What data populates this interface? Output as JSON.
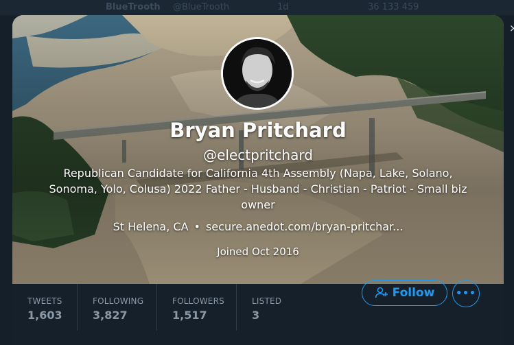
{
  "background_tweet": {
    "name": "BlueTrooth",
    "handle": "@BlueTrooth",
    "time": "1d",
    "stats": "36   133   459"
  },
  "profile": {
    "name": "Bryan Pritchard",
    "handle": "@electpritchard",
    "bio": "Republican Candidate for California 4th Assembly (Napa, Lake, Solano, Sonoma, Yolo, Colusa) 2022 Father - Husband - Christian - Patriot - Small biz owner",
    "location": "St Helena, CA",
    "separator": "•",
    "website": "secure.anedot.com/bryan-pritchar...",
    "joined": "Joined Oct 2016"
  },
  "stats": [
    {
      "label": "TWEETS",
      "value": "1,603"
    },
    {
      "label": "FOLLOWING",
      "value": "3,827"
    },
    {
      "label": "FOLLOWERS",
      "value": "1,517"
    },
    {
      "label": "LISTED",
      "value": "3"
    }
  ],
  "actions": {
    "follow_label": "Follow",
    "more_label": "•••",
    "close_label": "×"
  },
  "colors": {
    "background": "#15202b",
    "accent": "#1d9bf0",
    "muted": "#8b98a5"
  },
  "icons": [
    "close-icon",
    "add-user-icon",
    "more-icon"
  ]
}
